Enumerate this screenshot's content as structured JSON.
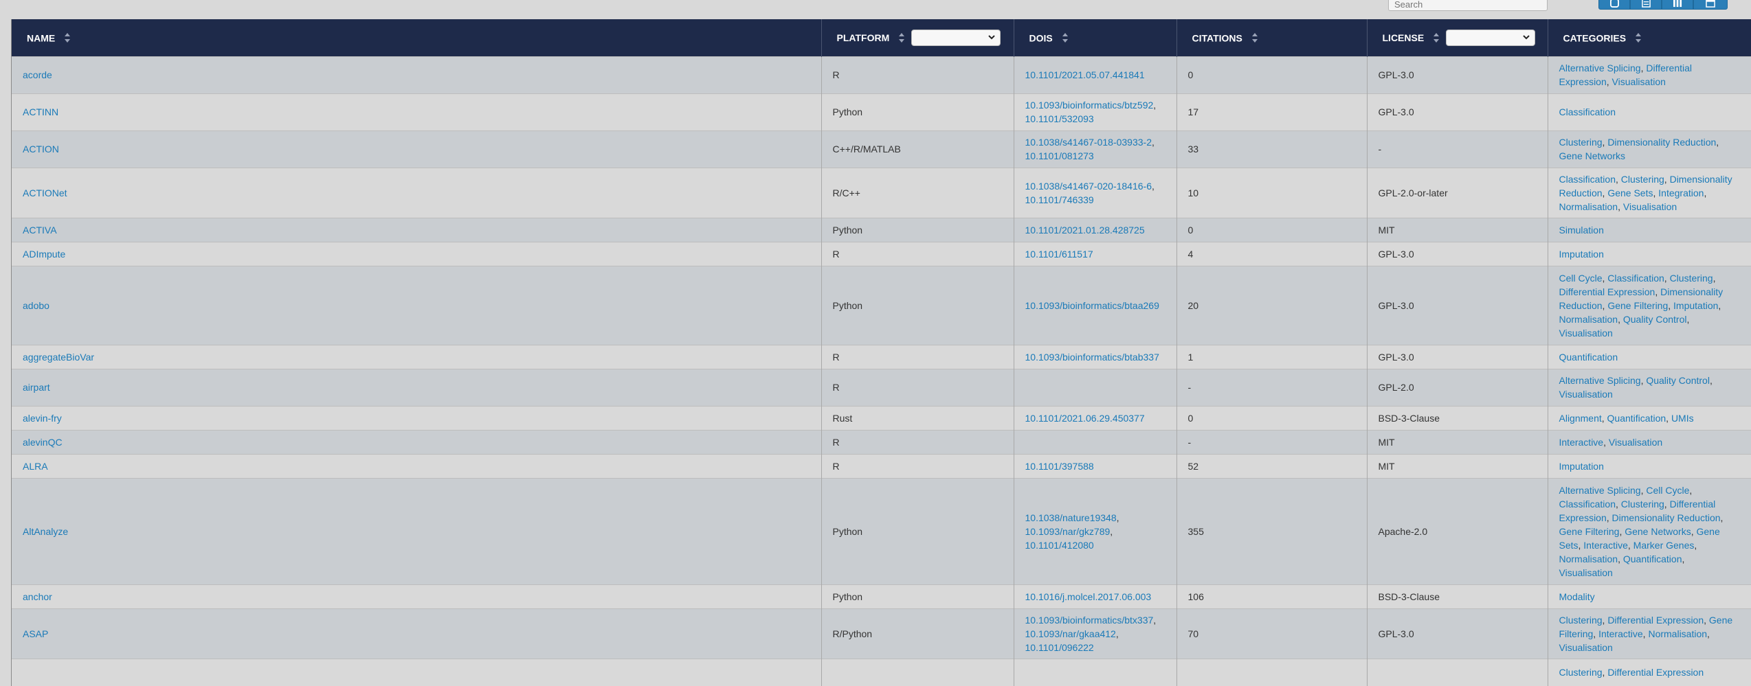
{
  "search": {
    "placeholder": "Search"
  },
  "toolbar": {
    "icons": [
      "refresh-icon",
      "toggle-icon",
      "columns-icon",
      "export-icon"
    ]
  },
  "columns": {
    "name": "NAME",
    "platform": "PLATFORM",
    "dois": "DOIS",
    "citations": "CITATIONS",
    "license": "LICENSE",
    "categories": "CATEGORIES"
  },
  "filters": {
    "platform_value": "",
    "license_value": ""
  },
  "colors": {
    "header_bg": "#1e2a4a",
    "link": "#1a7ab8",
    "row_odd": "#c9cdd1",
    "row_even": "#d9d9d9"
  },
  "rows": [
    {
      "name": "acorde",
      "platform": "R",
      "dois": [
        "10.1101/2021.05.07.441841"
      ],
      "citations": "0",
      "license": "GPL-3.0",
      "categories": [
        "Alternative Splicing",
        "Differential Expression",
        "Visualisation"
      ]
    },
    {
      "name": "ACTINN",
      "platform": "Python",
      "dois": [
        "10.1093/bioinformatics/btz592",
        "10.1101/532093"
      ],
      "citations": "17",
      "license": "GPL-3.0",
      "categories": [
        "Classification"
      ]
    },
    {
      "name": "ACTION",
      "platform": "C++/R/MATLAB",
      "dois": [
        "10.1038/s41467-018-03933-2",
        "10.1101/081273"
      ],
      "citations": "33",
      "license": "-",
      "categories": [
        "Clustering",
        "Dimensionality Reduction",
        "Gene Networks"
      ]
    },
    {
      "name": "ACTIONet",
      "platform": "R/C++",
      "dois": [
        "10.1038/s41467-020-18416-6",
        "10.1101/746339"
      ],
      "citations": "10",
      "license": "GPL-2.0-or-later",
      "categories": [
        "Classification",
        "Clustering",
        "Dimensionality Reduction",
        "Gene Sets",
        "Integration",
        "Normalisation",
        "Visualisation"
      ]
    },
    {
      "name": "ACTIVA",
      "platform": "Python",
      "dois": [
        "10.1101/2021.01.28.428725"
      ],
      "citations": "0",
      "license": "MIT",
      "categories": [
        "Simulation"
      ]
    },
    {
      "name": "ADImpute",
      "platform": "R",
      "dois": [
        "10.1101/611517"
      ],
      "citations": "4",
      "license": "GPL-3.0",
      "categories": [
        "Imputation"
      ]
    },
    {
      "name": "adobo",
      "platform": "Python",
      "dois": [
        "10.1093/bioinformatics/btaa269"
      ],
      "citations": "20",
      "license": "GPL-3.0",
      "categories": [
        "Cell Cycle",
        "Classification",
        "Clustering",
        "Differential Expression",
        "Dimensionality Reduction",
        "Gene Filtering",
        "Imputation",
        "Normalisation",
        "Quality Control",
        "Visualisation"
      ]
    },
    {
      "name": "aggregateBioVar",
      "platform": "R",
      "dois": [
        "10.1093/bioinformatics/btab337"
      ],
      "citations": "1",
      "license": "GPL-3.0",
      "categories": [
        "Quantification"
      ]
    },
    {
      "name": "airpart",
      "platform": "R",
      "dois": [],
      "citations": "-",
      "license": "GPL-2.0",
      "categories": [
        "Alternative Splicing",
        "Quality Control",
        "Visualisation"
      ]
    },
    {
      "name": "alevin-fry",
      "platform": "Rust",
      "dois": [
        "10.1101/2021.06.29.450377"
      ],
      "citations": "0",
      "license": "BSD-3-Clause",
      "categories": [
        "Alignment",
        "Quantification",
        "UMIs"
      ]
    },
    {
      "name": "alevinQC",
      "platform": "R",
      "dois": [],
      "citations": "-",
      "license": "MIT",
      "categories": [
        "Interactive",
        "Visualisation"
      ]
    },
    {
      "name": "ALRA",
      "platform": "R",
      "dois": [
        "10.1101/397588"
      ],
      "citations": "52",
      "license": "MIT",
      "categories": [
        "Imputation"
      ]
    },
    {
      "name": "AltAnalyze",
      "platform": "Python",
      "dois": [
        "10.1038/nature19348",
        "10.1093/nar/gkz789",
        "10.1101/412080"
      ],
      "citations": "355",
      "license": "Apache-2.0",
      "categories": [
        "Alternative Splicing",
        "Cell Cycle",
        "Classification",
        "Clustering",
        "Differential Expression",
        "Dimensionality Reduction",
        "Gene Filtering",
        "Gene Networks",
        "Gene Sets",
        "Interactive",
        "Marker Genes",
        "Normalisation",
        "Quantification",
        "Visualisation"
      ]
    },
    {
      "name": "anchor",
      "platform": "Python",
      "dois": [
        "10.1016/j.molcel.2017.06.003"
      ],
      "citations": "106",
      "license": "BSD-3-Clause",
      "categories": [
        "Modality"
      ]
    },
    {
      "name": "ASAP",
      "platform": "R/Python",
      "dois": [
        "10.1093/bioinformatics/btx337",
        "10.1093/nar/gkaa412",
        "10.1101/096222"
      ],
      "citations": "70",
      "license": "GPL-3.0",
      "categories": [
        "Clustering",
        "Differential Expression",
        "Gene Filtering",
        "Interactive",
        "Normalisation",
        "Visualisation"
      ]
    },
    {
      "name": "",
      "platform": "",
      "dois": [],
      "citations": "",
      "license": "",
      "categories": [
        "Clustering",
        "Differential Expression"
      ]
    }
  ]
}
